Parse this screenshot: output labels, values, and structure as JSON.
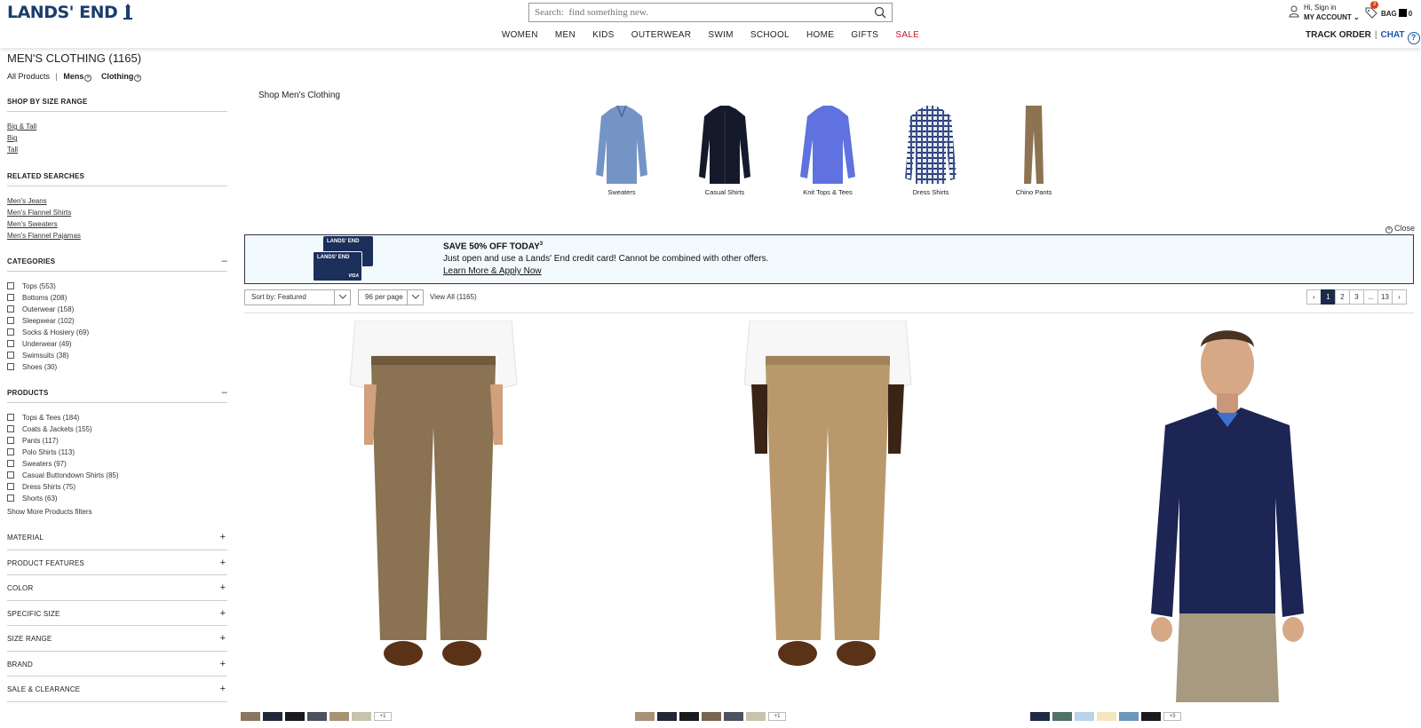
{
  "header": {
    "logo": "LANDS' END",
    "search_placeholder": "Search:  find something new.",
    "nav": [
      "WOMEN",
      "MEN",
      "KIDS",
      "OUTERWEAR",
      "SWIM",
      "SCHOOL",
      "HOME",
      "GIFTS",
      "SALE"
    ],
    "account_greeting": "Hi, Sign in",
    "account_label": "MY ACCOUNT",
    "wishlist_count": "3",
    "bag_label": "BAG",
    "bag_count": "0",
    "track_order": "TRACK ORDER",
    "chat": "CHAT"
  },
  "sidebar": {
    "title": "MEN'S CLOTHING (1165)",
    "crumb_all": "All Products",
    "crumb_sep": "|",
    "crumb_mens": "Mens",
    "crumb_clothing": "Clothing",
    "size_range_head": "SHOP BY SIZE RANGE",
    "size_links": [
      "Big & Tall",
      "Big",
      "Tall"
    ],
    "related_head": "RELATED SEARCHES",
    "related_links": [
      "Men's Jeans",
      "Men's Flannel Shirts",
      "Men's Sweaters",
      "Men's Flannel Pajamas"
    ],
    "categories_head": "CATEGORIES",
    "categories": [
      "Tops (553)",
      "Bottoms (208)",
      "Outerwear (158)",
      "Sleepwear (102)",
      "Socks & Hosiery (69)",
      "Underwear (49)",
      "Swimsuits (38)",
      "Shoes (30)"
    ],
    "products_head": "PRODUCTS",
    "products": [
      "Tops & Tees (184)",
      "Coats & Jackets (155)",
      "Pants (117)",
      "Polo Shirts (113)",
      "Sweaters (97)",
      "Casual Buttondown Shirts (85)",
      "Dress Shirts (75)",
      "Shorts (63)"
    ],
    "show_more": "Show More Products filters",
    "collapse_symbol": "–",
    "expand_symbol": "+",
    "accordions": [
      "MATERIAL",
      "PRODUCT FEATURES",
      "COLOR",
      "SPECIFIC SIZE",
      "SIZE RANGE",
      "BRAND",
      "SALE & CLEARANCE"
    ]
  },
  "main": {
    "shop_title": "Shop Men's Clothing",
    "category_tiles": [
      "Sweaters",
      "Casual Shirts",
      "Knit Tops & Tees",
      "Dress Shirts",
      "Chino Pants"
    ],
    "close": "Close",
    "promo": {
      "card_text": "LANDS' END",
      "card_visa": "VISA",
      "title": "SAVE 50% OFF TODAY",
      "sup": "3",
      "body": "Just open and use a Lands' End credit card! Cannot be combined with other offers.",
      "link": "Learn More & Apply Now"
    },
    "sort_label": "Sort by: Featured",
    "per_page": "96 per page",
    "view_all": "View All (1165)",
    "pages": [
      "1",
      "2",
      "3",
      "...",
      "13"
    ],
    "products": [
      {
        "swatches": [
          "#8a7560",
          "#222838",
          "#1a1a1f",
          "#4d5260",
          "#a89274",
          "#c9c3ad"
        ],
        "more": "+1"
      },
      {
        "swatches": [
          "#a89274",
          "#222838",
          "#1a1a1f",
          "#7a6650",
          "#4d5260",
          "#c9c3ad"
        ],
        "more": "+1"
      },
      {
        "swatches": [
          "#1f2a44",
          "#4e7368",
          "#b9d3ea",
          "#f4e6bd",
          "#6e96bd",
          "#1a1a1f"
        ],
        "more": "+3"
      }
    ],
    "colors": {
      "accent_navy": "#1a2b4a",
      "sale_red": "#c8102e",
      "chat_blue": "#1a5aa6",
      "promo_bg": "#f2fafd"
    }
  }
}
